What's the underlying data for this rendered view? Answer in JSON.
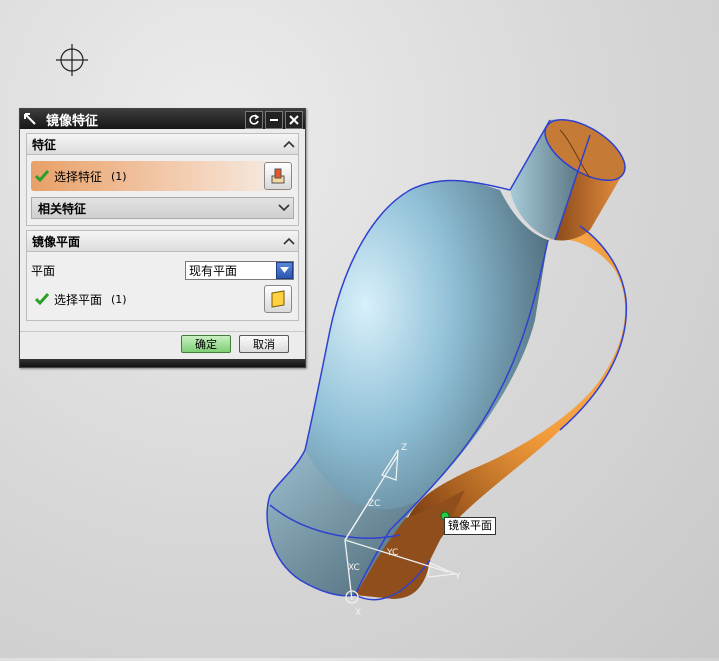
{
  "dialog": {
    "title": "镜像特征",
    "feature_section": {
      "header": "特征",
      "select_label": "选择特征",
      "select_count": "(1)",
      "related_label": "相关特征"
    },
    "plane_section": {
      "header": "镜像平面",
      "plane_label": "平面",
      "plane_value": "现有平面",
      "select_label": "选择平面",
      "select_count": "(1)"
    },
    "ok_label": "确定",
    "cancel_label": "取消"
  },
  "viewport": {
    "axis_labels": {
      "z": "Z",
      "zc": "ZC",
      "yc": "YC",
      "y": "Y",
      "xc": "XC",
      "x": "X"
    },
    "mirror_plane_tooltip": "镜像平面"
  },
  "colors": {
    "check_green": "#2aa02a",
    "body_blue": "#8fb4c8",
    "body_orange": "#e38a2c",
    "edge_blue": "#3040d0"
  }
}
